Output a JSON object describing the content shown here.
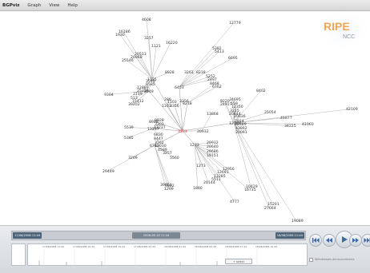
{
  "menubar": {
    "app_name": "BGPviz",
    "items": [
      "Graph",
      "View",
      "Help"
    ]
  },
  "logo": {
    "text_main": "RIPE",
    "text_sub": "NCC"
  },
  "graph": {
    "center_node": "3333",
    "hubs": [
      "1125",
      "8218",
      "1103",
      "3356",
      "3549",
      "6453",
      "6762",
      "8928",
      "12389",
      "20932",
      "13237",
      "1273"
    ],
    "nodes": [
      "4608",
      "12779",
      "16186",
      "1930",
      "3257",
      "16220",
      "1121",
      "5382",
      "5413",
      "20513",
      "20968",
      "6695",
      "25546",
      "8928",
      "3261",
      "8218",
      "5252",
      "2497",
      "8468",
      "6762",
      "3549",
      "8585",
      "12989",
      "25229",
      "9304",
      "2119",
      "513",
      "15412",
      "39202",
      "286",
      "1103",
      "3356",
      "8220",
      "24917",
      "34695",
      "559",
      "12350",
      "3215",
      "20844",
      "20636",
      "8402",
      "2914",
      "25054",
      "41877",
      "41960",
      "42109",
      "12389",
      "34225",
      "43892",
      "20091",
      "13868",
      "8928",
      "3303",
      "5539",
      "13237",
      "5385",
      "6830",
      "8447",
      "3762",
      "13030",
      "4589",
      "3257",
      "5560",
      "20932",
      "20640",
      "29686",
      "19151",
      "1273",
      "3269",
      "29449",
      "12956",
      "12691",
      "13285",
      "5511",
      "20144",
      "9002",
      "1299",
      "10429",
      "16735",
      "4777",
      "15201",
      "27664",
      "19089",
      "39851",
      "1880"
    ]
  },
  "timeline": {
    "start_label": "17/06/2008 11:44",
    "end_label": "18/06/2008 11:44",
    "handle_label": "2008-06-18 11:44",
    "tick_labels": [
      "17/06/2008 13:44",
      "17/06/2008 16:44",
      "17/06/2008 19:44",
      "17/06/2008 22:44",
      "18/06/2008 01:44",
      "18/06/2008 04:44",
      "18/06/2008 07:44",
      "18/06/2008 10:44"
    ],
    "button_label": "+ select",
    "status_text": "Withdrawals  Announcements"
  }
}
